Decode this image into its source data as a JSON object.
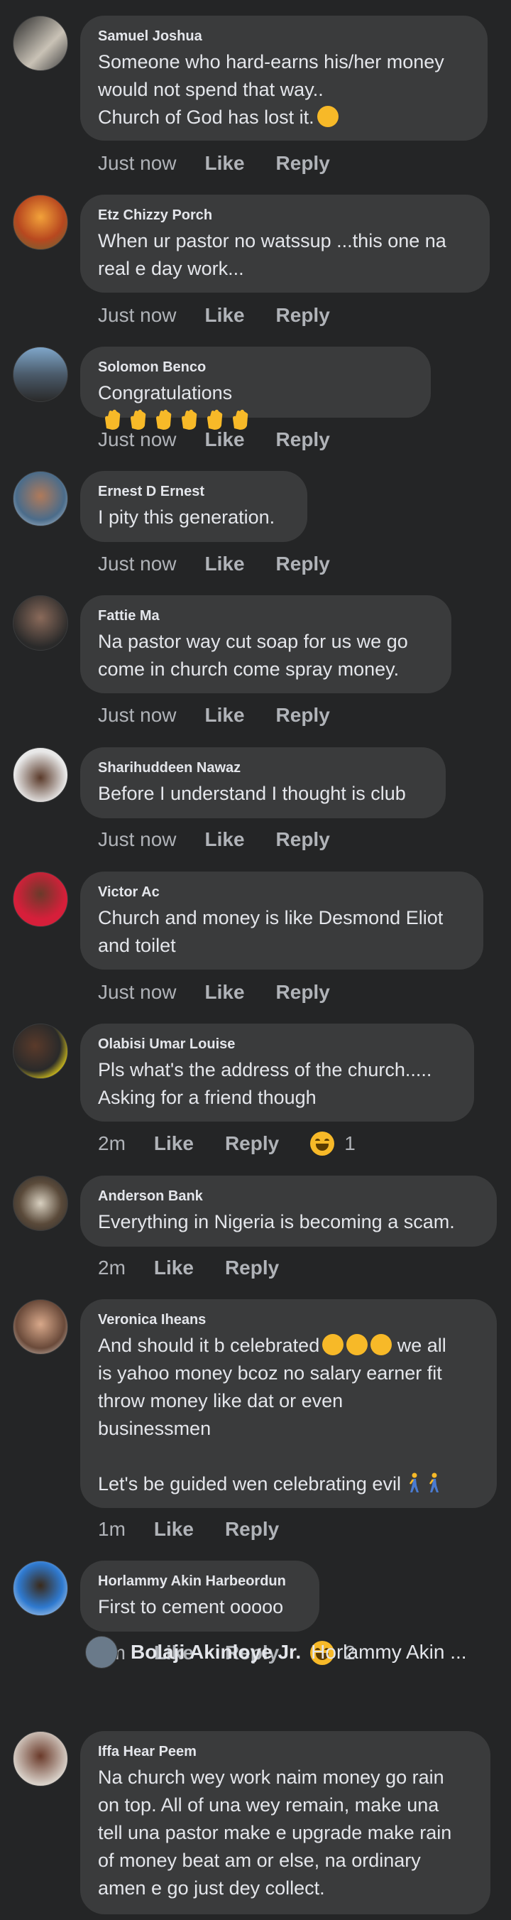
{
  "comments": [
    {
      "name": "Samuel Joshua",
      "text": "Someone who hard-earns his/her money\nwould not spend that way..\nChurch of God has lost it.",
      "time": "Just now",
      "like": "Like",
      "reply": "Reply"
    },
    {
      "name": "Etz Chizzy Porch",
      "text": "When ur pastor no watssup ...this one na\nreal  e day work...",
      "time": "Just now",
      "like": "Like",
      "reply": "Reply"
    },
    {
      "name": "Solomon Benco",
      "text": "Congratulations",
      "time": "Just now",
      "like": "Like",
      "reply": "Reply"
    },
    {
      "name": "Ernest D Ernest",
      "text": "I pity this generation.",
      "time": "Just now",
      "like": "Like",
      "reply": "Reply"
    },
    {
      "name": "Fattie Ma",
      "text": "Na pastor way cut soap for us we go\ncome in church come spray money.",
      "time": "Just now",
      "like": "Like",
      "reply": "Reply"
    },
    {
      "name": "Sharihuddeen Nawaz",
      "text": "Before I understand I thought is club",
      "time": "Just now",
      "like": "Like",
      "reply": "Reply"
    },
    {
      "name": "Victor Ac",
      "text": "Church and money is like Desmond Eliot\nand toilet",
      "time": "Just now",
      "like": "Like",
      "reply": "Reply"
    },
    {
      "name": "Olabisi Umar Louise",
      "text": "Pls what's the address of the church.....\nAsking for a friend though",
      "time": "2m",
      "like": "Like",
      "reply": "Reply",
      "reaction_count": "1"
    },
    {
      "name": "Anderson Bank",
      "text": "Everything in Nigeria is becoming a scam.",
      "time": "2m",
      "like": "Like",
      "reply": "Reply"
    },
    {
      "name": "Veronica Iheans",
      "text": "And should it b celebrated",
      "text2": " we all\nis yahoo money bcoz no salary earner fit\nthrow money like dat or even\nbusinessmen\n\nLet's be guided wen celebrating evil",
      "time": "1m",
      "like": "Like",
      "reply": "Reply"
    },
    {
      "name": "Horlammy Akin Harbeordun",
      "text": "First to cement ooooo",
      "time": "5m",
      "like": "Like",
      "reply": "Reply",
      "reaction_count": "2"
    },
    {
      "name": "Iffa Hear Peem",
      "text": "Na church wey work naim money go rain\non top. All of una wey remain, make una\ntell una pastor make e upgrade make rain\nof money beat am or else, na ordinary\namen e go just dey collect."
    }
  ],
  "reply_preview": {
    "name": "Bolaji Akinloye Jr.",
    "text": "Horlammy Akin ..."
  },
  "colors": {
    "background": "#242526",
    "bubble": "#3a3b3c",
    "text": "#e4e6eb",
    "secondary": "#b0b3b8",
    "reaction": "#f7b928"
  }
}
